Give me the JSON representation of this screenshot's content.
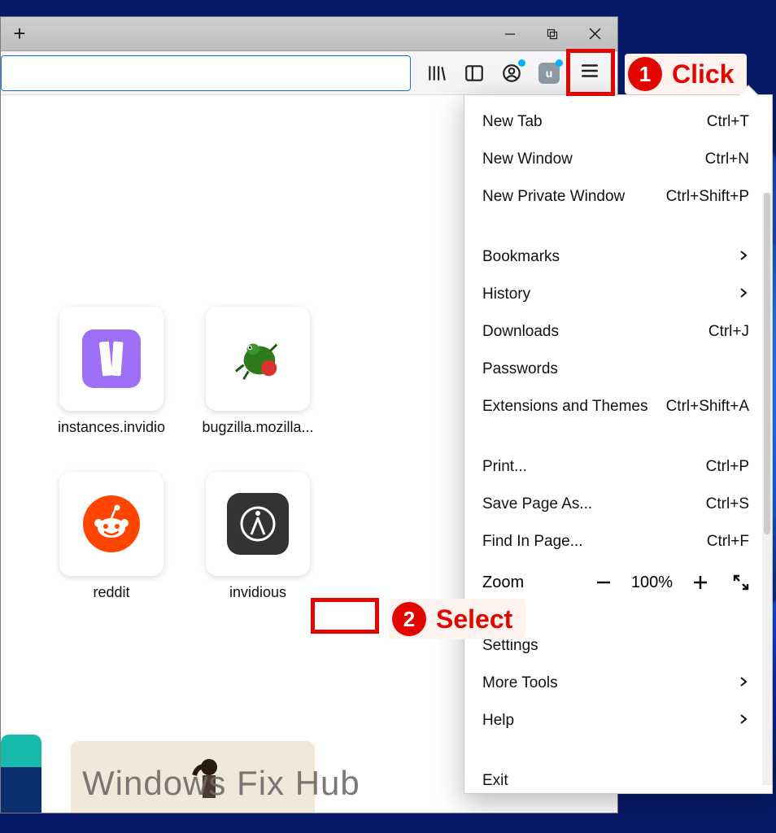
{
  "window_controls": {
    "minimize": "minimize",
    "maximize": "maximize",
    "close": "close"
  },
  "toolbar": {
    "icons": [
      "library",
      "reader",
      "account",
      "ublock",
      "hamburger"
    ],
    "ublock_label": "u"
  },
  "annotations": {
    "step1_num": "1",
    "step1_text": "Click",
    "step2_num": "2",
    "step2_text": "Select"
  },
  "menu": {
    "new_tab": "New Tab",
    "new_tab_short": "Ctrl+T",
    "new_window": "New Window",
    "new_window_short": "Ctrl+N",
    "new_private": "New Private Window",
    "new_private_short": "Ctrl+Shift+P",
    "bookmarks": "Bookmarks",
    "history": "History",
    "downloads": "Downloads",
    "downloads_short": "Ctrl+J",
    "passwords": "Passwords",
    "extensions": "Extensions and Themes",
    "extensions_short": "Ctrl+Shift+A",
    "print": "Print...",
    "print_short": "Ctrl+P",
    "save_as": "Save Page As...",
    "save_as_short": "Ctrl+S",
    "find": "Find In Page...",
    "find_short": "Ctrl+F",
    "zoom": "Zoom",
    "zoom_val": "100%",
    "settings": "Settings",
    "more_tools": "More Tools",
    "help": "Help",
    "exit": "Exit"
  },
  "tiles": {
    "t1_label": "instances.invidio",
    "t2_label": "bugzilla.mozilla...",
    "t3_label": "reddit",
    "t4_label": "invidious"
  },
  "watermark": "Windows Fix Hub"
}
